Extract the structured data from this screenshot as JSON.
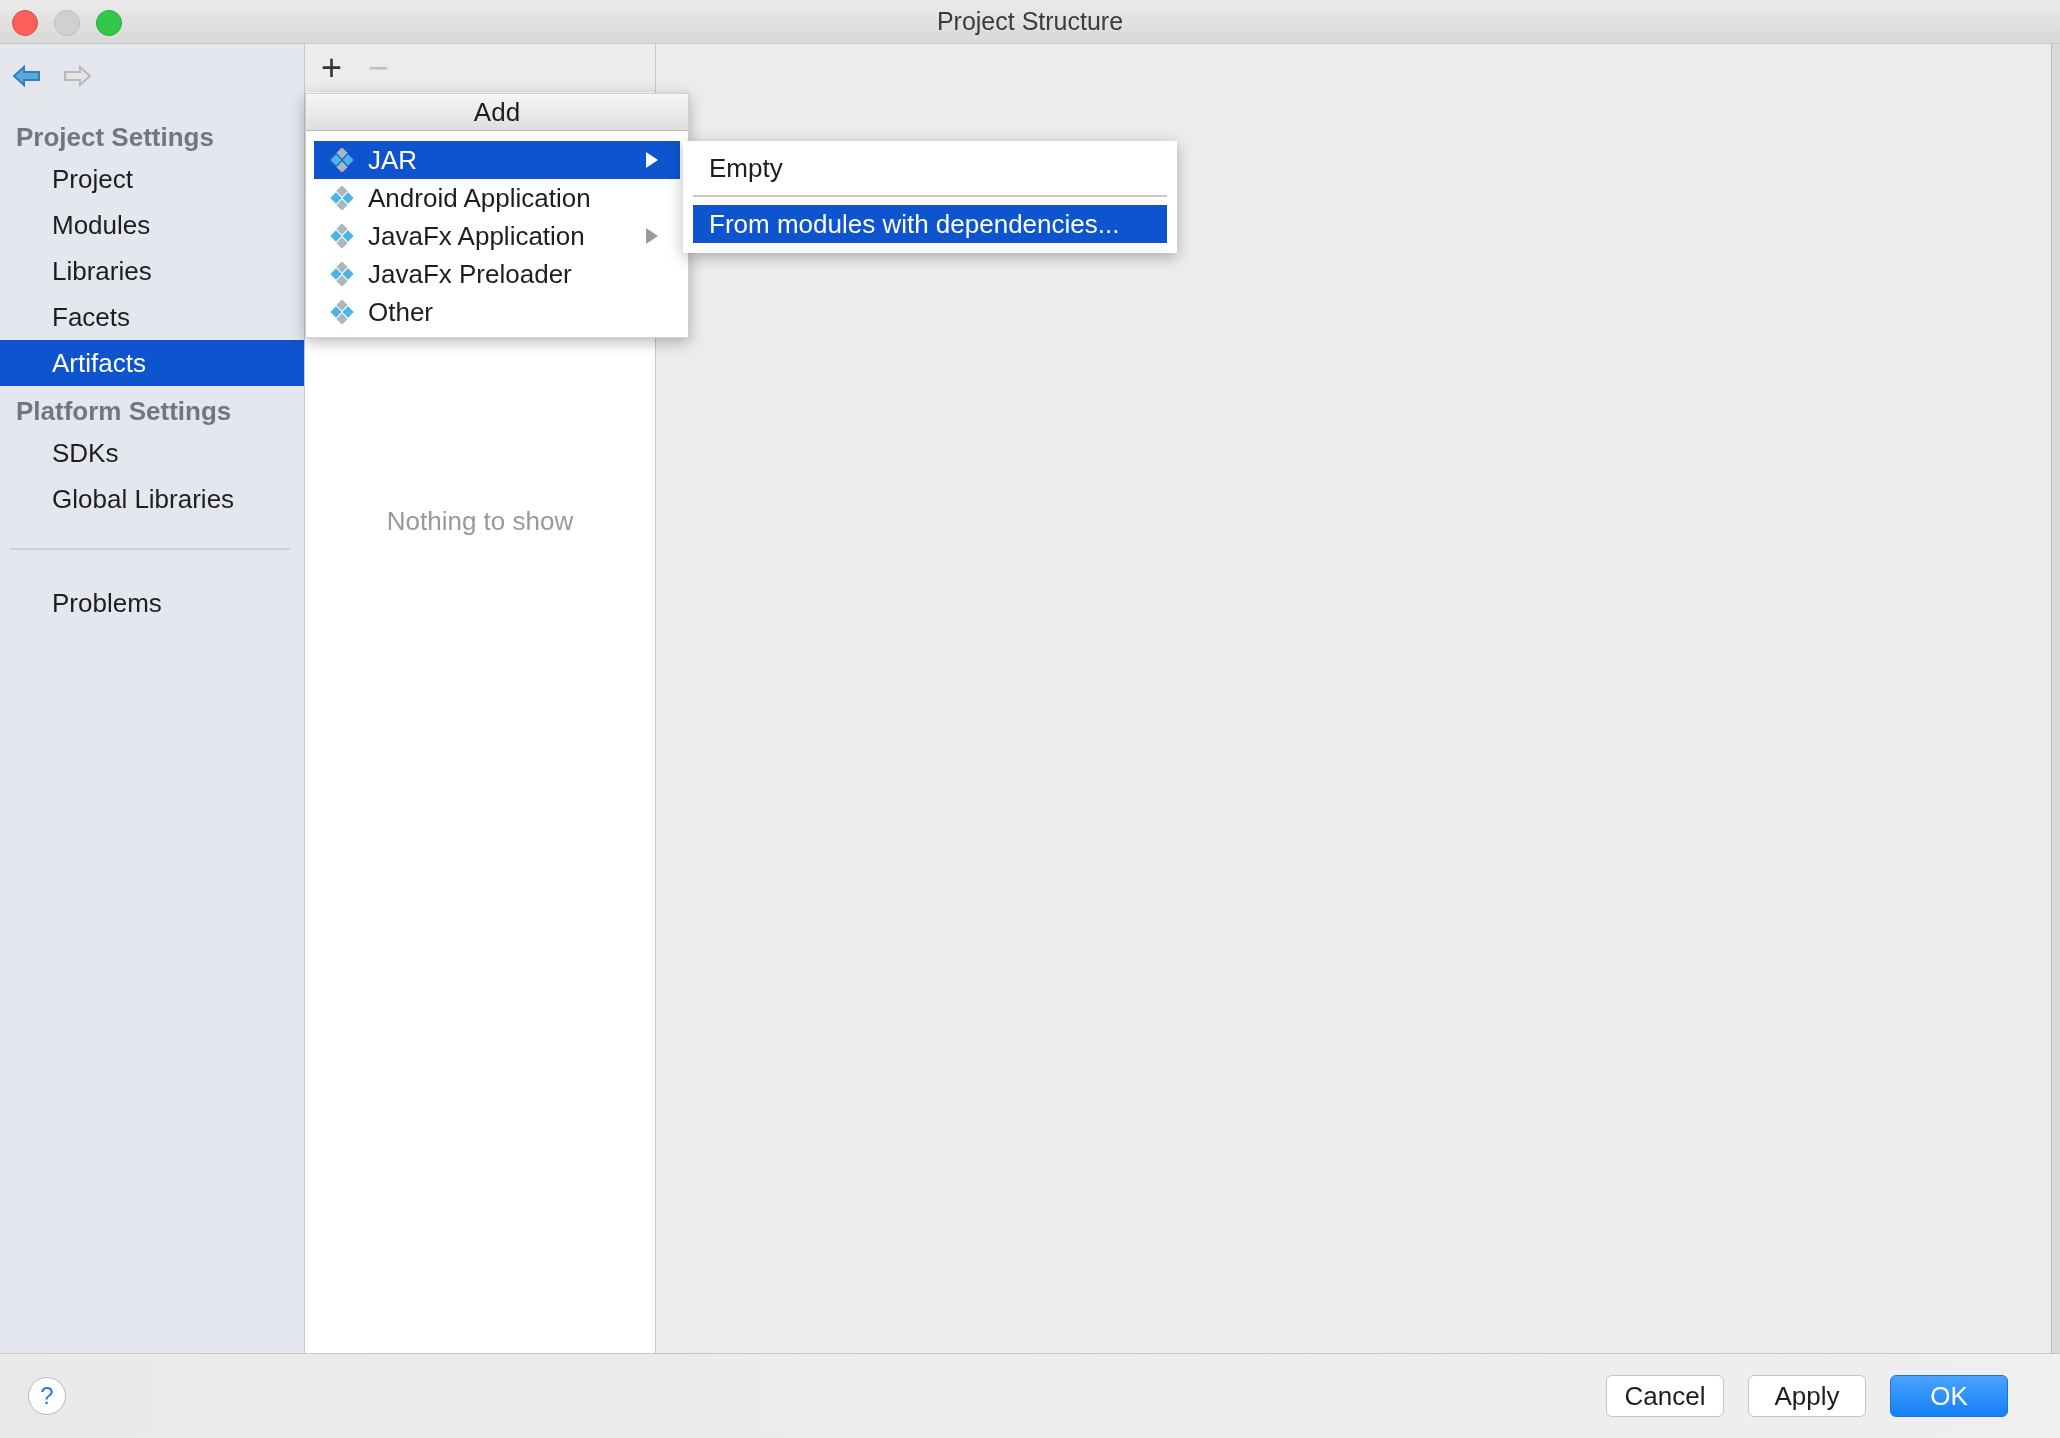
{
  "window": {
    "title": "Project Structure"
  },
  "toolbar": {
    "add": {
      "label": "+",
      "disabled": false
    },
    "remove": {
      "label": "−",
      "disabled": true
    }
  },
  "sidebar": {
    "sections": [
      {
        "title": "Project Settings",
        "items": [
          {
            "label": "Project",
            "selected": false
          },
          {
            "label": "Modules",
            "selected": false
          },
          {
            "label": "Libraries",
            "selected": false
          },
          {
            "label": "Facets",
            "selected": false
          },
          {
            "label": "Artifacts",
            "selected": true
          }
        ]
      },
      {
        "title": "Platform Settings",
        "items": [
          {
            "label": "SDKs",
            "selected": false
          },
          {
            "label": "Global Libraries",
            "selected": false
          }
        ]
      }
    ],
    "footer_items": [
      {
        "label": "Problems",
        "selected": false
      }
    ]
  },
  "list_panel": {
    "empty_text": "Nothing to show"
  },
  "add_menu": {
    "title": "Add",
    "items": [
      {
        "label": "JAR",
        "selected": true,
        "submenu": true
      },
      {
        "label": "Android Application",
        "selected": false,
        "submenu": false
      },
      {
        "label": "JavaFx Application",
        "selected": false,
        "submenu": true
      },
      {
        "label": "JavaFx Preloader",
        "selected": false,
        "submenu": false
      },
      {
        "label": "Other",
        "selected": false,
        "submenu": false
      }
    ]
  },
  "submenu": {
    "items": [
      {
        "label": "Empty",
        "selected": false
      },
      {
        "label": "From modules with dependencies...",
        "selected": true
      }
    ]
  },
  "footer": {
    "help": "?",
    "buttons": [
      {
        "label": "Cancel",
        "default": false
      },
      {
        "label": "Apply",
        "default": false
      },
      {
        "label": "OK",
        "default": true
      }
    ]
  }
}
